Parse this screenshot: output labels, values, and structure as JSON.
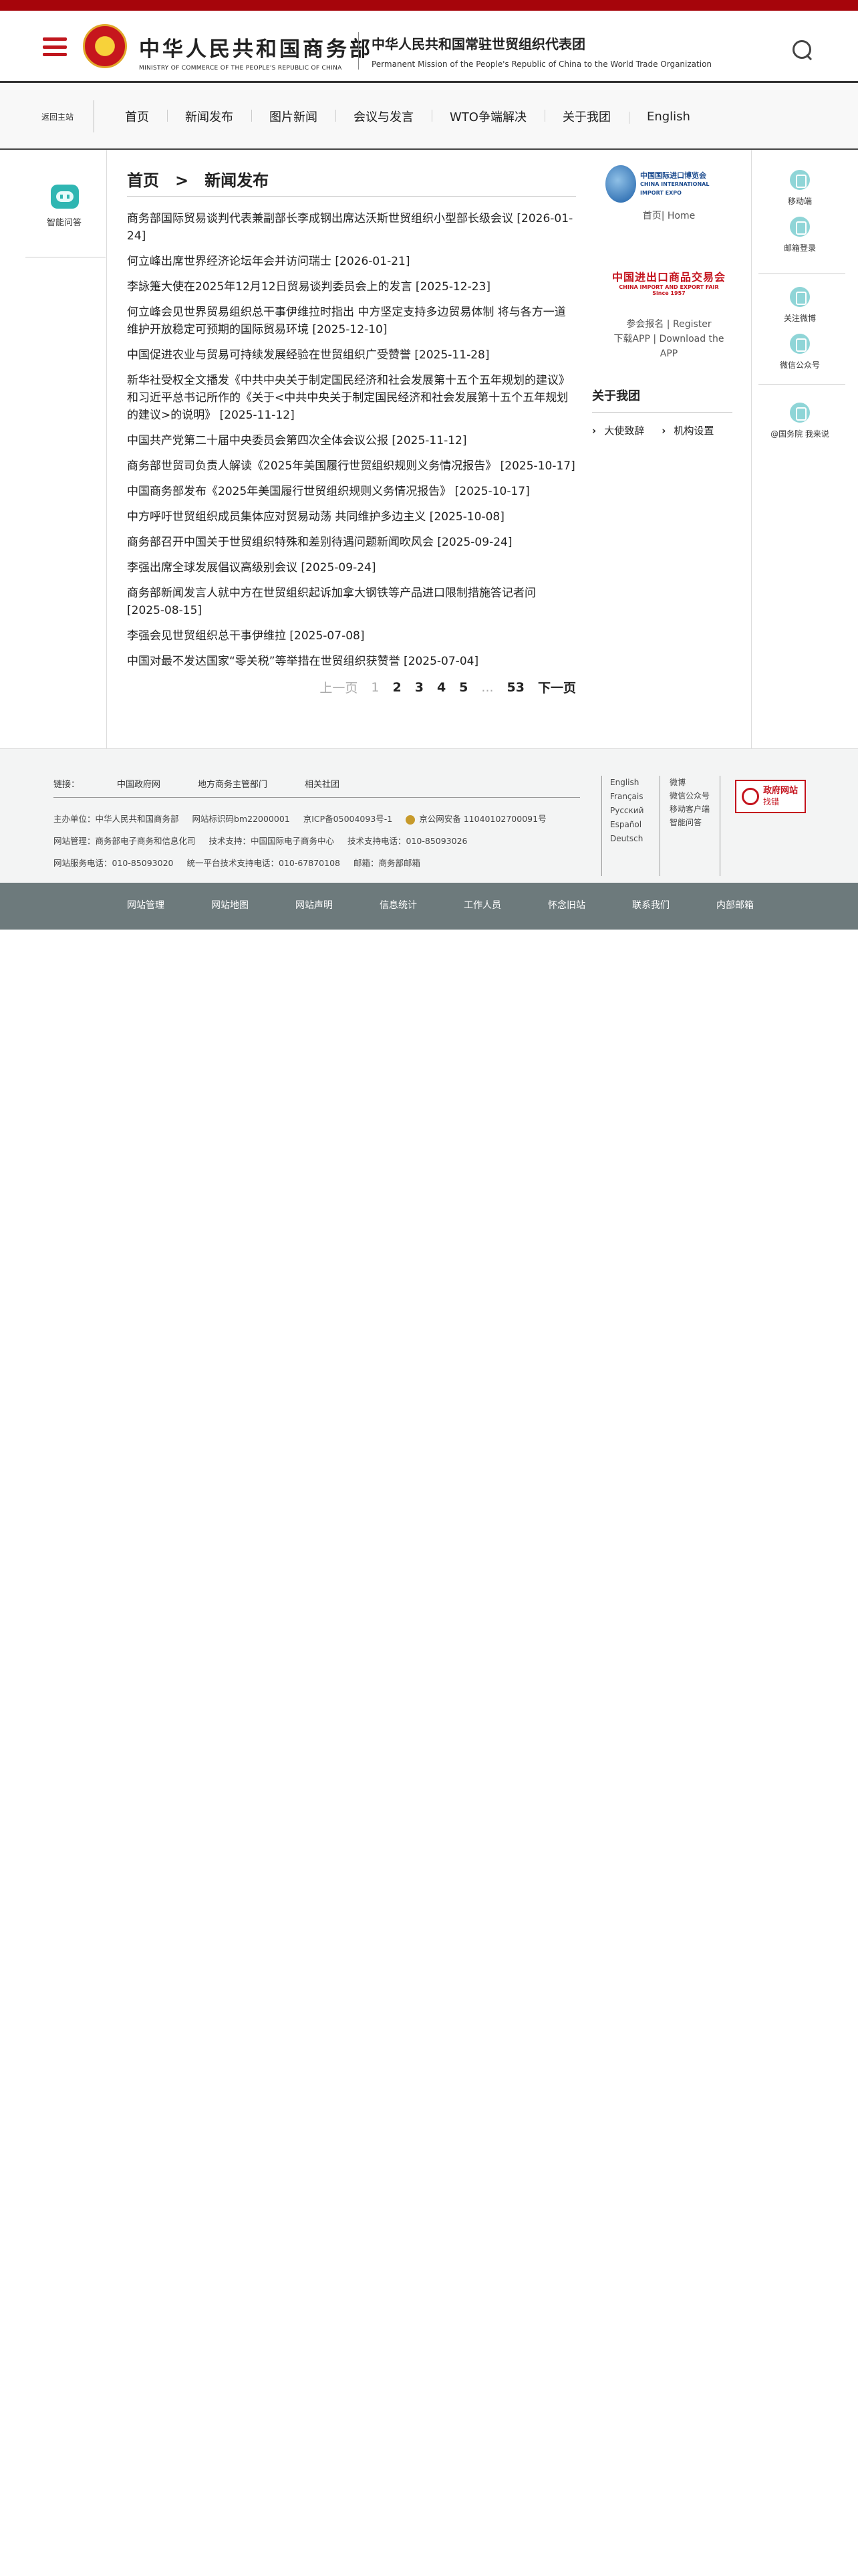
{
  "header": {
    "ministry_cn": "中华人民共和国商务部",
    "ministry_en": "MINISTRY OF COMMERCE OF THE PEOPLE'S REPUBLIC OF CHINA",
    "mission_cn": "中华人民共和国常驻世贸组织代表团",
    "mission_en": "Permanent Mission of the People's Republic of China to the World Trade Organization"
  },
  "nav": {
    "back_home": "返回主站",
    "items": [
      "首页",
      "新闻发布",
      "图片新闻",
      "会议与发言",
      "WTO争端解决",
      "关于我团",
      "English"
    ]
  },
  "left_sidebar": {
    "assistant_label": "智能问答"
  },
  "breadcrumb": {
    "home": "首页",
    "separator": ">",
    "current": "新闻发布"
  },
  "articles": [
    "商务部国际贸易谈判代表兼副部长李成钢出席达沃斯世贸组织小型部长级会议 [2026-01-24]",
    "何立峰出席世界经济论坛年会并访问瑞士 [2026-01-21]",
    "李詠箑大使在2025年12月12日贸易谈判委员会上的发言 [2025-12-23]",
    "何立峰会见世界贸易组织总干事伊维拉时指出 中方坚定支持多边贸易体制 将与各方一道维护开放稳定可预期的国际贸易环境 [2025-12-10]",
    "中国促进农业与贸易可持续发展经验在世贸组织广受赞誉 [2025-11-28]",
    "新华社受权全文播发《中共中央关于制定国民经济和社会发展第十五个五年规划的建议》和习近平总书记所作的《关于<中共中央关于制定国民经济和社会发展第十五个五年规划的建议>的说明》 [2025-11-12]",
    "中国共产党第二十届中央委员会第四次全体会议公报 [2025-11-12]",
    "商务部世贸司负责人解读《2025年美国履行世贸组织规则义务情况报告》 [2025-10-17]",
    "中国商务部发布《2025年美国履行世贸组织规则义务情况报告》 [2025-10-17]",
    "中方呼吁世贸组织成员集体应对贸易动荡 共同维护多边主义 [2025-10-08]",
    "商务部召开中国关于世贸组织特殊和差别待遇问题新闻吹风会 [2025-09-24]",
    "李强出席全球发展倡议高级别会议 [2025-09-24]",
    "商务部新闻发言人就中方在世贸组织起诉加拿大钢铁等产品进口限制措施答记者问 [2025-08-15]",
    "李强会见世贸组织总干事伊维拉 [2025-07-08]",
    "中国对最不发达国家“零关税”等举措在世贸组织获赞誉 [2025-07-04]"
  ],
  "pagination": {
    "prev": "上一页",
    "current": "1",
    "pages": [
      "2",
      "3",
      "4",
      "5"
    ],
    "ellipsis": "...",
    "last": "53",
    "next": "下一页"
  },
  "right_panel": {
    "expo_logo_cn": "中国国际进口博览会",
    "expo_logo_en": "CHINA INTERNATIONAL IMPORT EXPO",
    "expo_caption": "首页| Home",
    "canton_logo_cn": "中国进出口商品交易会",
    "canton_logo_en": "CHINA IMPORT AND EXPORT FAIR",
    "canton_logo_year": "Since 1957",
    "canton_caption_1": "参会报名 | Register",
    "canton_caption_2": "下载APP | Download the APP",
    "about_title": "关于我团",
    "about_links": [
      "大使致辞",
      "机构设置"
    ]
  },
  "right_sidebar": {
    "items": [
      "移动端",
      "邮箱登录",
      "关注微博",
      "微信公众号",
      "@国务院 我来说"
    ]
  },
  "footer": {
    "links_label": "链接：",
    "links": [
      "中国政府网",
      "地方商务主管部门",
      "相关社团"
    ],
    "info_row1": [
      "主办单位：中华人民共和国商务部",
      "网站标识码bm22000001",
      "京ICP备05004093号-1",
      "京公网安备 11040102700091号"
    ],
    "info_row2": [
      "网站管理：商务部电子商务和信息化司",
      "技术支持：中国国际电子商务中心",
      "技术支持电话：010-85093026"
    ],
    "info_row3": [
      "网站服务电话：010-85093020",
      "统一平台技术支持电话：010-67870108",
      "邮箱：商务部邮箱"
    ],
    "languages": [
      "English",
      "Français",
      "Русский",
      "Español",
      "Deutsch"
    ],
    "socials": [
      "微博",
      "微信公众号",
      "移动客户端",
      "智能问答"
    ],
    "gov_logo_line1": "政府网站",
    "gov_logo_line2": "找错"
  },
  "bottom_bar": [
    "网站管理",
    "网站地图",
    "网站声明",
    "信息统计",
    "工作人员",
    "怀念旧站",
    "联系我们",
    "内部邮箱"
  ]
}
